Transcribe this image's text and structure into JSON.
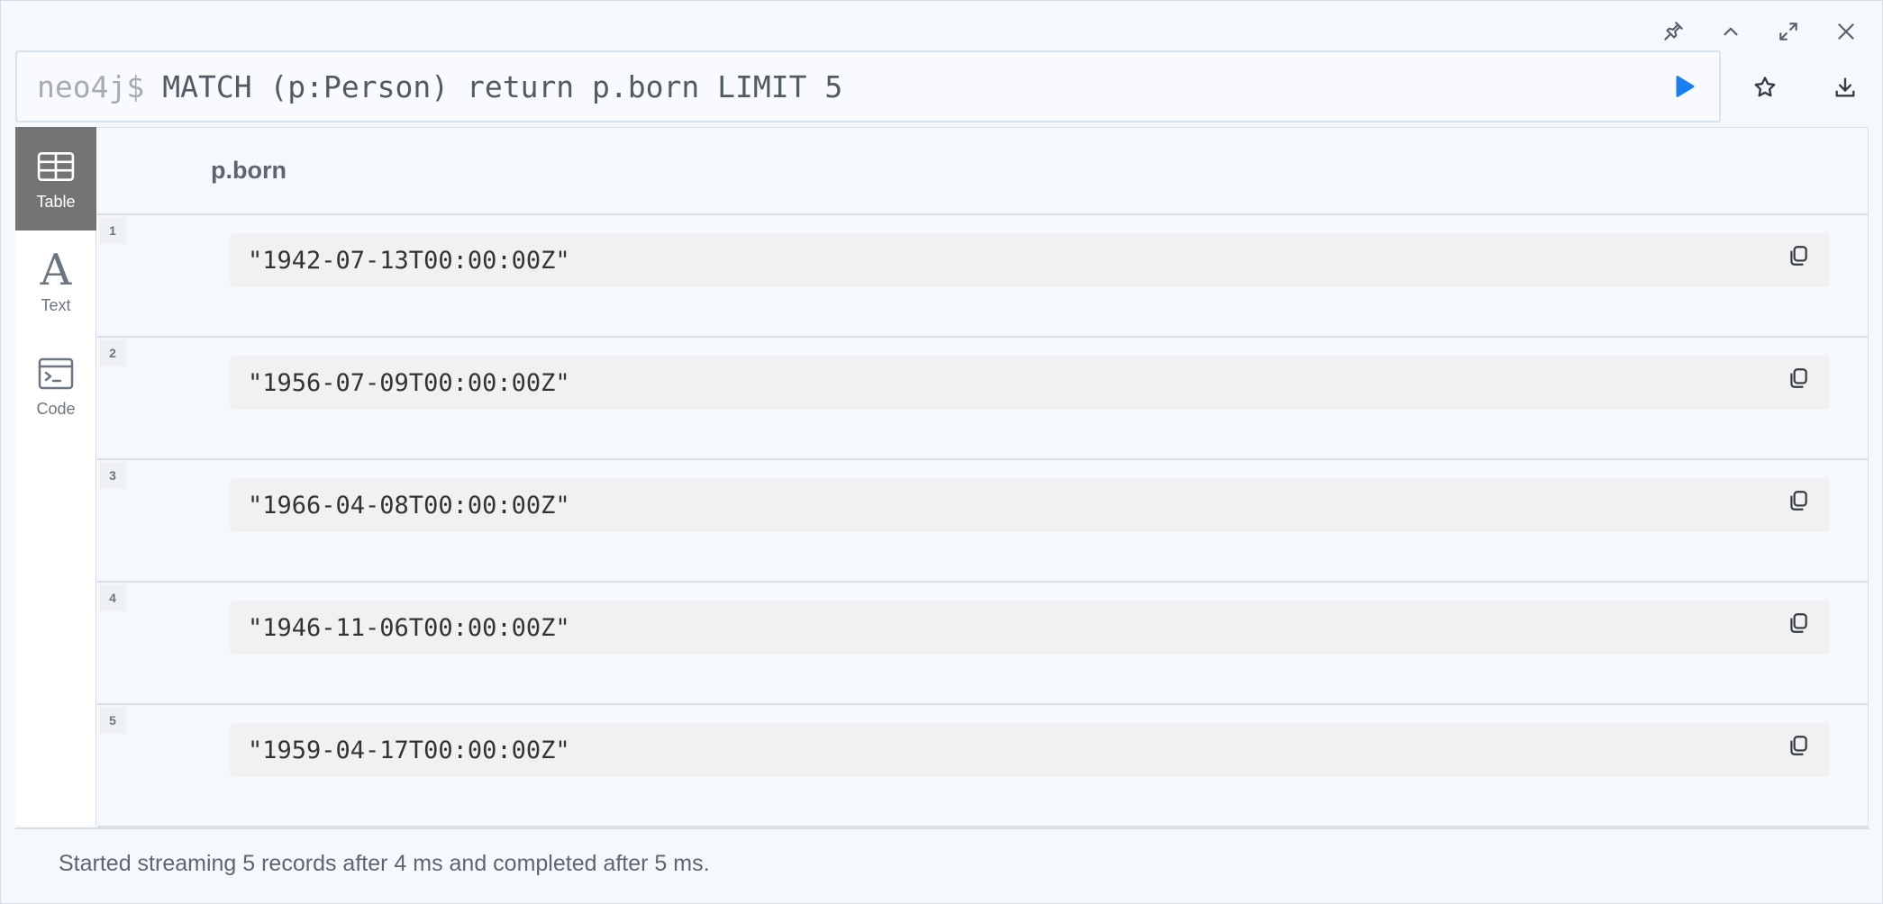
{
  "window_controls": [
    {
      "icon": "pin-icon"
    },
    {
      "icon": "collapse-icon"
    },
    {
      "icon": "fullscreen-icon"
    },
    {
      "icon": "close-icon"
    }
  ],
  "editor": {
    "prompt": "neo4j$",
    "query": "MATCH (p:Person) return p.born LIMIT 5",
    "run_icon": "play-icon",
    "accent_color": "#1a7ff0"
  },
  "editor_actions": [
    {
      "icon": "star-icon"
    },
    {
      "icon": "download-icon"
    }
  ],
  "views": [
    {
      "label": "Table",
      "icon": "table-icon",
      "active": true
    },
    {
      "label": "Text",
      "icon": "text-icon",
      "active": false
    },
    {
      "label": "Code",
      "icon": "code-icon",
      "active": false
    }
  ],
  "table": {
    "column": "p.born",
    "rows": [
      {
        "num": "1",
        "value": "\"1942-07-13T00:00:00Z\""
      },
      {
        "num": "2",
        "value": "\"1956-07-09T00:00:00Z\""
      },
      {
        "num": "3",
        "value": "\"1966-04-08T00:00:00Z\""
      },
      {
        "num": "4",
        "value": "\"1946-11-06T00:00:00Z\""
      },
      {
        "num": "5",
        "value": "\"1959-04-17T00:00:00Z\""
      }
    ]
  },
  "status": "Started streaming 5 records after 4 ms and completed after 5 ms."
}
